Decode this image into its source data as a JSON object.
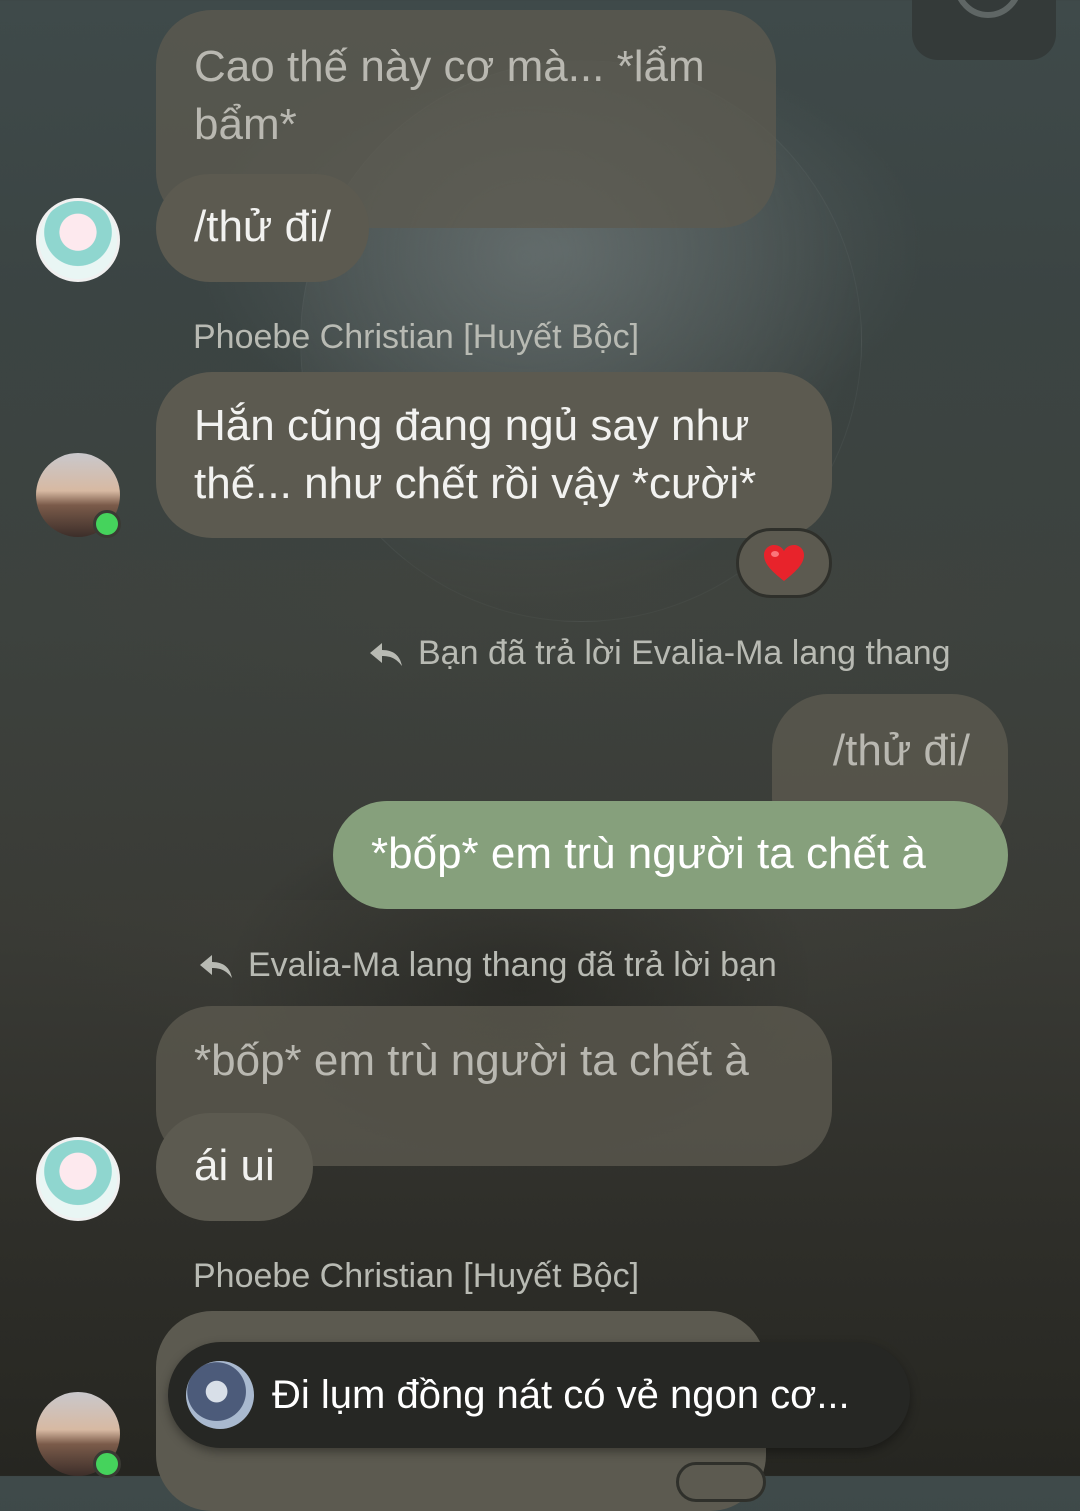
{
  "messages": {
    "m1_text": "Cao thế này cơ mà... *lẩm bẩm*",
    "m2_text": "/thử đi/",
    "sender1": "Phoebe Christian [Huyết Bộc]",
    "m3_text": "Hắn cũng đang ngủ say như thế... như chết rồi vậy *cười*",
    "m3_reaction": "heart",
    "reply_note_1": "Bạn đã trả lời Evalia-Ma lang thang",
    "quoted_1": "/thử đi/",
    "m4_text": "*bốp* em trù người ta chết à",
    "reply_note_2": "Evalia-Ma lang thang đã trả lời bạn",
    "quoted_2": "*bốp* em trù người ta chết à",
    "m5_text": "ái ui",
    "sender2": "Phoebe Christian [Huyết Bộc]"
  },
  "toast": {
    "text": "Đi lụm đồng nát có vẻ ngon cơ..."
  },
  "colors": {
    "bubble_other": "#5c5a50",
    "bubble_mine": "#86a07c",
    "online": "#45d35c"
  },
  "icons": {
    "reply": "reply-arrow-icon",
    "heart": "heart-icon"
  }
}
